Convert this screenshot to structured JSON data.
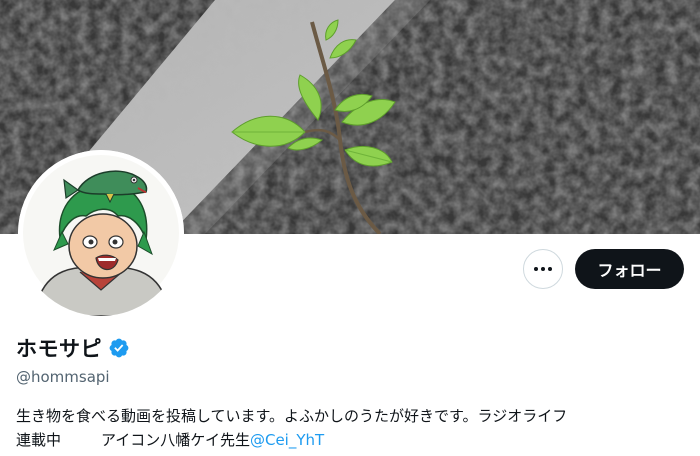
{
  "profile": {
    "display_name": "ホモサピ",
    "handle": "@hommsapi",
    "bio_line1": "生き物を食べる動画を投稿しています。よふかしのうたが好きです。ラジオライフ",
    "bio_line2_part1": "連載中",
    "bio_line2_part2": "アイコン八幡ケイ先生",
    "bio_mention": "@Cei_YhT",
    "verified": true
  },
  "actions": {
    "more_icon": "more-horizontal-icon",
    "follow_label": "フォロー"
  },
  "colors": {
    "accent": "#1d9bf0",
    "text_primary": "#0f1419",
    "text_secondary": "#536471",
    "follow_bg": "#0f1419",
    "border": "#cfd9de"
  }
}
